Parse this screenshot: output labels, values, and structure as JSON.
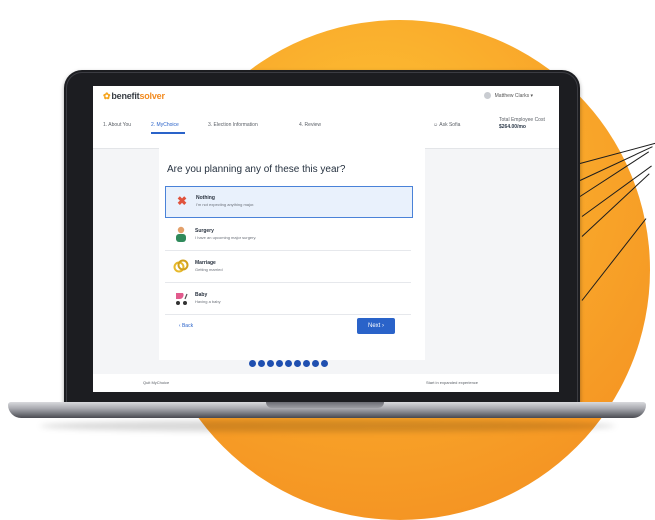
{
  "app": {
    "logo_prefix": "benefit",
    "logo_accent": "solver",
    "user_name": "Matthew Clarks",
    "ask_sofia": "Ask Sofia",
    "cost_label": "Total Employee Cost",
    "cost_value": "$264.00/mo",
    "steps": [
      "1. About You",
      "2. MyChoice",
      "3. Election Information",
      "4. Review"
    ]
  },
  "main": {
    "question": "Are you planning any of these this year?",
    "options": [
      {
        "title": "Nothing",
        "subtitle": "I'm not expecting anything major.",
        "icon": "x-icon",
        "selected": true
      },
      {
        "title": "Surgery",
        "subtitle": "I have an upcoming major surgery.",
        "icon": "person-icon",
        "selected": false
      },
      {
        "title": "Marriage",
        "subtitle": "Getting married",
        "icon": "rings-icon",
        "selected": false
      },
      {
        "title": "Baby",
        "subtitle": "Having a baby",
        "icon": "stroller-icon",
        "selected": false
      }
    ],
    "back_label": "Back",
    "next_label": "Next"
  },
  "footer": {
    "left": "Quit MyChoice",
    "right": "Start in expanded experience"
  },
  "progress": {
    "dot_count": 9
  },
  "colors": {
    "accent": "#2a63c9",
    "brand_orange": "#f6a51f",
    "circle_orange": "#f28a1f"
  }
}
